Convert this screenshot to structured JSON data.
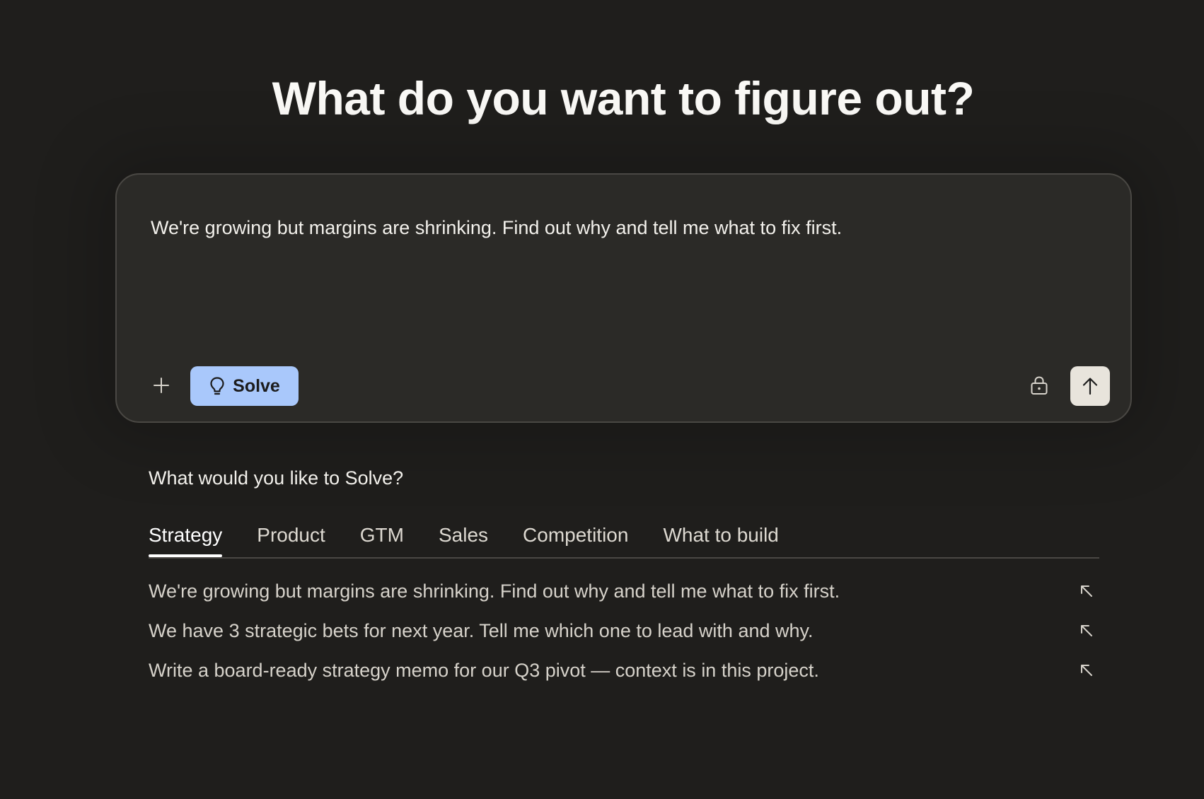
{
  "header": {
    "title": "What do you want to figure out?"
  },
  "composer": {
    "value": "We're growing but margins are shrinking. Find out why and tell me what to fix first.",
    "solve_label": "Solve",
    "plus_icon": "plus-icon",
    "solve_icon": "lightbulb-icon",
    "lock_icon": "lock-icon",
    "send_icon": "arrow-up-icon",
    "solve_color": "#a9c8fb",
    "send_color": "#e8e4dc"
  },
  "suggestions": {
    "heading": "What would you like to Solve?",
    "tabs": [
      {
        "label": "Strategy",
        "active": true
      },
      {
        "label": "Product",
        "active": false
      },
      {
        "label": "GTM",
        "active": false
      },
      {
        "label": "Sales",
        "active": false
      },
      {
        "label": "Competition",
        "active": false
      },
      {
        "label": "What to build",
        "active": false
      }
    ],
    "items": [
      {
        "text": "We're growing but margins are shrinking. Find out why and tell me what to fix first.",
        "icon": "arrow-up-left-icon"
      },
      {
        "text": "We have 3 strategic bets for next year. Tell me which one to lead with and why.",
        "icon": "arrow-up-left-icon"
      },
      {
        "text": "Write a board-ready strategy memo for our Q3 pivot — context is in this project.",
        "icon": "arrow-up-left-icon"
      }
    ]
  },
  "colors": {
    "background": "#1f1e1c",
    "composer_background": "#2b2a27",
    "border": "#4a4844"
  }
}
